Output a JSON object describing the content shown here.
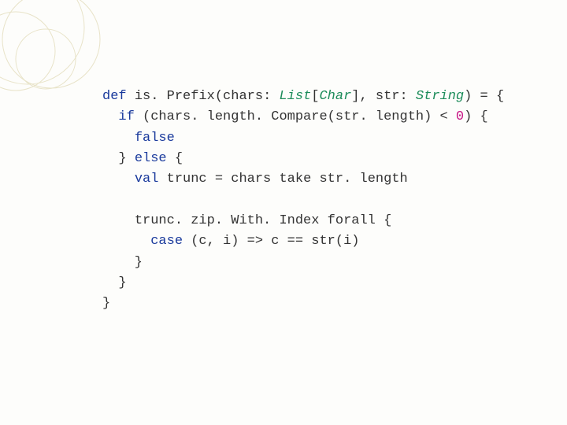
{
  "code": {
    "kw_def": "def",
    "fn_name": "is. Prefix",
    "param1_name": "chars",
    "param1_type_outer": "List",
    "param1_type_inner": "Char",
    "param2_name": "str",
    "param2_type": "String",
    "kw_if": "if",
    "cond_call_obj": "chars",
    "cond_call_method": "length. Compare",
    "cond_call_arg": "str. length",
    "cond_op": "<",
    "cond_rhs": "0",
    "kw_false": "false",
    "kw_else": "else",
    "kw_val": "val",
    "val_name": "trunc",
    "val_rhs_obj": "chars",
    "val_rhs_method": "take",
    "val_rhs_arg": "str. length",
    "expr_obj": "trunc",
    "expr_method1": "zip. With. Index",
    "expr_method2": "forall",
    "kw_case": "case",
    "case_pat": "(c, i)",
    "case_arrow": "=>",
    "case_lhs": "c",
    "case_eq": "==",
    "case_rhs": "str(i)"
  }
}
